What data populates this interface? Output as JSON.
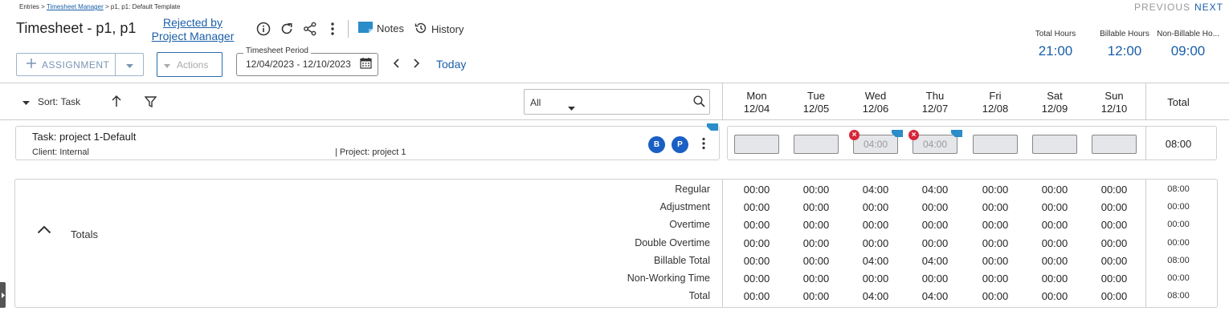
{
  "breadcrumb": {
    "root": "Entries",
    "sep": " > ",
    "link": "Timesheet Manager",
    "current": "p1, p1: Default Template"
  },
  "header": {
    "title": "Timesheet - p1, p1",
    "status_link": "Rejected by Project Manager",
    "notes_label": "Notes",
    "history_label": "History",
    "previous_label": "PREVIOUS",
    "next_label": "NEXT"
  },
  "kpis": [
    {
      "label": "Total Hours",
      "value": "21:00"
    },
    {
      "label": "Billable Hours",
      "value": "12:00"
    },
    {
      "label": "Non-Billable Ho...",
      "value": "09:00"
    }
  ],
  "toolbar": {
    "assignment_label": "ASSIGNMENT",
    "actions_label": "Actions",
    "period_label": "Timesheet Period",
    "period_value": "12/04/2023 - 12/10/2023",
    "today_label": "Today"
  },
  "grid": {
    "sort_label": "Sort: Task",
    "filter_value": "All",
    "days": [
      {
        "name": "Mon",
        "date": "12/04"
      },
      {
        "name": "Tue",
        "date": "12/05"
      },
      {
        "name": "Wed",
        "date": "12/06"
      },
      {
        "name": "Thu",
        "date": "12/07"
      },
      {
        "name": "Fri",
        "date": "12/08"
      },
      {
        "name": "Sat",
        "date": "12/09"
      },
      {
        "name": "Sun",
        "date": "12/10"
      }
    ],
    "total_label": "Total"
  },
  "task": {
    "name": "Task: project 1-Default",
    "client": "Client: Internal",
    "project": "|  Project: project 1",
    "badge_b": "B",
    "badge_p": "P",
    "cells": [
      "",
      "",
      "04:00",
      "04:00",
      "",
      "",
      ""
    ],
    "total": "08:00"
  },
  "totals": {
    "label": "Totals",
    "rows": [
      {
        "label": "Regular",
        "values": [
          "00:00",
          "00:00",
          "04:00",
          "04:00",
          "00:00",
          "00:00",
          "00:00"
        ],
        "total": "08:00"
      },
      {
        "label": "Adjustment",
        "values": [
          "00:00",
          "00:00",
          "00:00",
          "00:00",
          "00:00",
          "00:00",
          "00:00"
        ],
        "total": "00:00"
      },
      {
        "label": "Overtime",
        "values": [
          "00:00",
          "00:00",
          "00:00",
          "00:00",
          "00:00",
          "00:00",
          "00:00"
        ],
        "total": "00:00"
      },
      {
        "label": "Double Overtime",
        "values": [
          "00:00",
          "00:00",
          "00:00",
          "00:00",
          "00:00",
          "00:00",
          "00:00"
        ],
        "total": "00:00"
      },
      {
        "label": "Billable Total",
        "values": [
          "00:00",
          "00:00",
          "04:00",
          "04:00",
          "00:00",
          "00:00",
          "00:00"
        ],
        "total": "08:00"
      },
      {
        "label": "Non-Working Time",
        "values": [
          "00:00",
          "00:00",
          "00:00",
          "00:00",
          "00:00",
          "00:00",
          "00:00"
        ],
        "total": "00:00"
      },
      {
        "label": "Total",
        "values": [
          "00:00",
          "00:00",
          "04:00",
          "04:00",
          "00:00",
          "00:00",
          "00:00"
        ],
        "total": "08:00"
      }
    ]
  },
  "colors": {
    "accent": "#1a5fa8",
    "badge": "#1a5fc4",
    "error": "#d6263a",
    "note": "#2a8cc8"
  }
}
